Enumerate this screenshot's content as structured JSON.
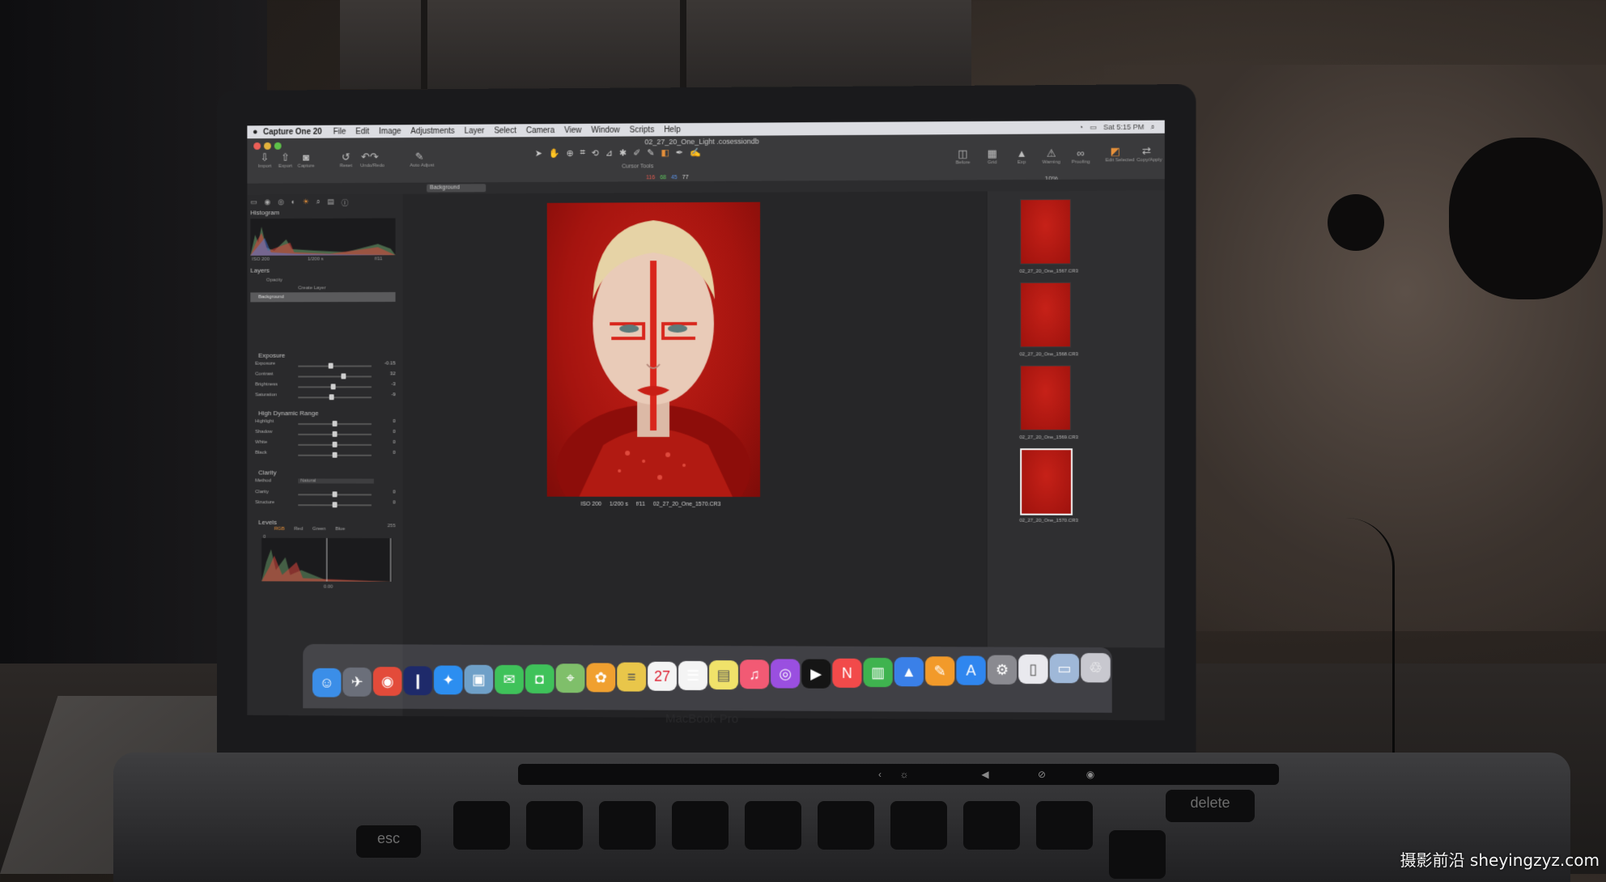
{
  "menubar": {
    "apple_icon": "apple-icon",
    "app_name": "Capture One 20",
    "items": [
      "File",
      "Edit",
      "Image",
      "Adjustments",
      "Layer",
      "Select",
      "Camera",
      "View",
      "Window",
      "Scripts",
      "Help"
    ],
    "clock": "Sat 5:15 PM"
  },
  "window": {
    "title": "02_27_20_One_Light .cosessiondb"
  },
  "toolbar": {
    "left_tools": [
      {
        "icon": "import-icon",
        "label": "Import"
      },
      {
        "icon": "export-icon",
        "label": "Export"
      },
      {
        "icon": "camera-icon",
        "label": "Capture"
      },
      {
        "icon": "reset-icon",
        "label": "Reset"
      },
      {
        "icon": "undo-icon",
        "label": "Undo/Redo"
      },
      {
        "icon": "auto-adjust-icon",
        "label": "Auto Adjust"
      }
    ],
    "cursor_tools_label": "Cursor Tools",
    "rgb_readout": {
      "r": "116",
      "g": "68",
      "b": "45",
      "a": "77"
    },
    "right_tools": [
      {
        "icon": "before-icon",
        "label": "Before"
      },
      {
        "icon": "grid-icon",
        "label": "Grid"
      },
      {
        "icon": "exposure-warning-icon",
        "label": "Exp"
      },
      {
        "icon": "warning-icon",
        "label": "Warning"
      },
      {
        "icon": "proofing-icon",
        "label": "Proofing"
      }
    ],
    "far_right_tools": [
      {
        "icon": "edit-selected-icon",
        "label": "Edit Selected"
      },
      {
        "icon": "copy-apply-icon",
        "label": "Copy/Apply"
      }
    ],
    "zoom": "10%",
    "layer_select": "Background"
  },
  "left_panel": {
    "histogram": {
      "title": "Histogram",
      "iso": "ISO 200",
      "shutter": "1/200 s",
      "aperture": "f/11"
    },
    "layers": {
      "title": "Layers",
      "opacity_label": "Opacity",
      "new_layer": "Create Layer",
      "layer_name": "Background"
    },
    "exposure": {
      "title": "Exposure",
      "sliders": [
        {
          "label": "Exposure",
          "value": "-0.15",
          "pos": 0.45
        },
        {
          "label": "Contrast",
          "value": "32",
          "pos": 0.62
        },
        {
          "label": "Brightness",
          "value": "-3",
          "pos": 0.48
        },
        {
          "label": "Saturation",
          "value": "-9",
          "pos": 0.46
        }
      ]
    },
    "hdr": {
      "title": "High Dynamic Range",
      "sliders": [
        {
          "label": "Highlight",
          "value": "0",
          "pos": 0.5
        },
        {
          "label": "Shadow",
          "value": "0",
          "pos": 0.5
        },
        {
          "label": "White",
          "value": "0",
          "pos": 0.5
        },
        {
          "label": "Black",
          "value": "0",
          "pos": 0.5
        }
      ]
    },
    "clarity": {
      "title": "Clarity",
      "method_label": "Method",
      "method_value": "Natural",
      "sliders": [
        {
          "label": "Clarity",
          "value": "0",
          "pos": 0.5
        },
        {
          "label": "Structure",
          "value": "0",
          "pos": 0.5
        }
      ]
    },
    "levels": {
      "title": "Levels",
      "channels": [
        "RGB",
        "Red",
        "Green",
        "Blue"
      ],
      "low": "0",
      "high": "255",
      "mid": "0.00"
    }
  },
  "viewer": {
    "caption": {
      "iso": "ISO 200",
      "shutter": "1/200 s",
      "aperture": "f/11",
      "filename": "02_27_20_One_1570.CR3"
    }
  },
  "browser": {
    "thumbnails": [
      {
        "name": "02_27_20_One_1567.CR3",
        "selected": false
      },
      {
        "name": "02_27_20_One_1568.CR3",
        "selected": false
      },
      {
        "name": "02_27_20_One_1569.CR3",
        "selected": false
      },
      {
        "name": "02_27_20_One_1570.CR3",
        "selected": true
      }
    ]
  },
  "dock": {
    "apps": [
      "finder-icon",
      "launchpad-icon",
      "chrome-icon",
      "capture-one-icon",
      "safari-icon",
      "preview-icon",
      "messages-icon",
      "facetime-icon",
      "maps-icon",
      "photos-icon",
      "notes-icon",
      "calendar-icon",
      "reminders-icon",
      "stickies-icon",
      "music-icon",
      "podcasts-icon",
      "tv-icon",
      "news-icon",
      "numbers-icon",
      "keynote-icon",
      "pages-icon",
      "app-store-icon",
      "system-preferences-icon",
      "document-icon",
      "folder-icon",
      "trash-icon"
    ],
    "calendar_day": "27"
  },
  "laptop": {
    "brand": "MacBook Pro"
  },
  "keyboard": {
    "delete_label": "delete",
    "esc_label": "esc"
  },
  "watermark": "摄影前沿 sheyingzyz.com",
  "colors": {
    "accent": "#e7913a",
    "photo_red": "#c62118"
  }
}
